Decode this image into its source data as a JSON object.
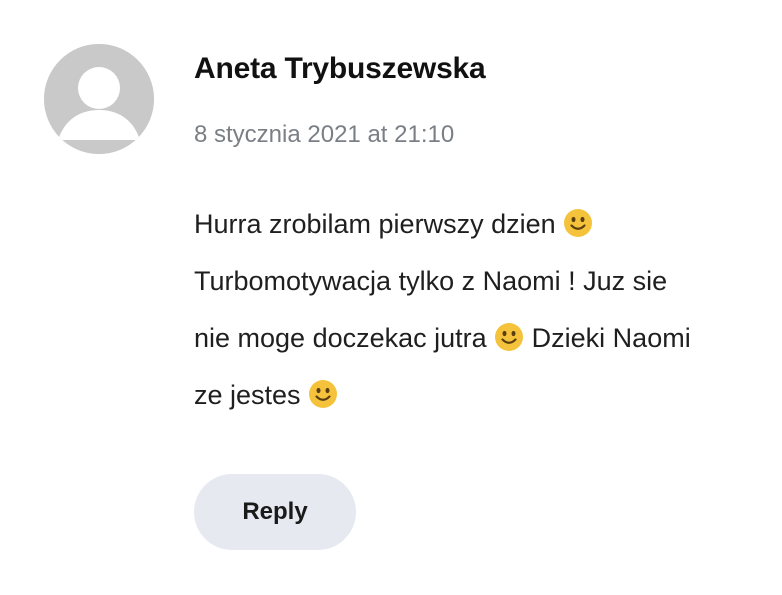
{
  "comment": {
    "author": "Aneta Trybuszewska",
    "date": "8 stycznia 2021 at 21:10",
    "lines": [
      {
        "text": "Hurra zrobilam pierwszy dzien ",
        "emoji": "slightly-smiling-face-icon",
        "after": ""
      },
      {
        "text": "Turbomotywacja tylko z Naomi ! Juz sie",
        "emoji": null,
        "after": ""
      },
      {
        "text": "nie moge doczekac jutra ",
        "emoji": "slightly-smiling-face-icon",
        "after": " Dzieki Naomi"
      },
      {
        "text": "ze jestes ",
        "emoji": "slightly-smiling-face-icon",
        "after": ""
      }
    ],
    "reply_label": "Reply"
  },
  "colors": {
    "avatar_bg": "#c9c9c9",
    "avatar_fg": "#ffffff",
    "date_text": "#7a7f86",
    "reply_bg": "#e6e9f0",
    "emoji_face": "#f5c33b",
    "emoji_features": "#5a3e12"
  }
}
